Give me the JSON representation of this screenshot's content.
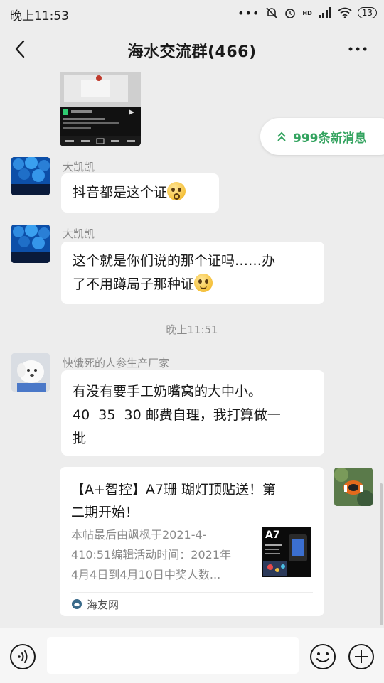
{
  "status_bar": {
    "time": "晚上11:53",
    "battery": "13",
    "network": "HD"
  },
  "header": {
    "title": "海水交流群(466)"
  },
  "new_messages_label": "999条新消息",
  "messages": [
    {
      "sender": "大凯凯",
      "text": "抖音都是这个证"
    },
    {
      "sender": "大凯凯",
      "line1": "这个就是你们说的那个证吗……办",
      "line2": "了不用蹲局子那种证"
    },
    {
      "sender": "快饿死的人参生产厂家",
      "line1": "有没有要手工奶嘴窝的大中小。",
      "line2": "40  35  30 邮费自理，我打算做一",
      "line3": "批"
    }
  ],
  "time_separator": "晚上11:51",
  "link_card": {
    "title_line1": "【A+智控】A7珊 瑚灯顶贴送！第",
    "title_line2": "二期开始！",
    "desc_line1": "本帖最后由飒枫于2021-4-",
    "desc_line2": "410:51编辑活动时间：2021年",
    "desc_line3": "4月4日到4月10日中奖人数...",
    "thumb_label": "A7",
    "source": "海友网"
  },
  "colors": {
    "accent_green": "#33a35f",
    "background": "#ededed",
    "bubble": "#ffffff"
  }
}
